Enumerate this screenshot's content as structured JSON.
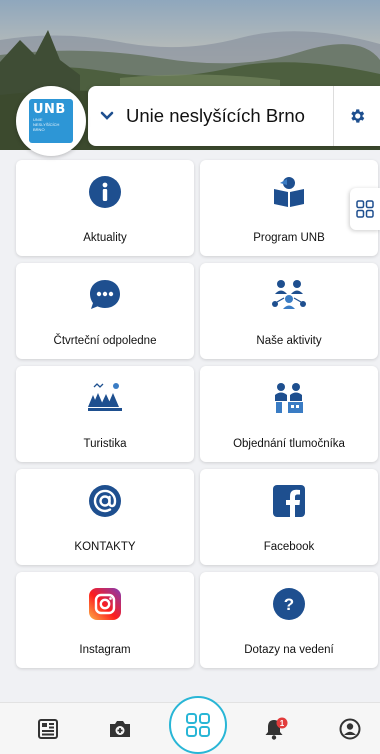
{
  "header": {
    "org_name": "Unie neslyšících Brno",
    "logo_text": "UNB",
    "logo_subtext": [
      "UNIE",
      "NESLYŠÍCÍCH",
      "BRNO"
    ]
  },
  "tiles": [
    {
      "label": "Aktuality",
      "icon": "info-icon"
    },
    {
      "label": "Program UNB",
      "icon": "reading-book-icon"
    },
    {
      "label": "Čtvrteční odpoledne",
      "icon": "chat-bubble-icon"
    },
    {
      "label": "Naše aktivity",
      "icon": "people-network-icon"
    },
    {
      "label": "Turistika",
      "icon": "forest-hiking-icon"
    },
    {
      "label": "Objednání tlumočníka",
      "icon": "interpreter-icon"
    },
    {
      "label": "KONTAKTY",
      "icon": "at-sign-icon"
    },
    {
      "label": "Facebook",
      "icon": "facebook-icon"
    },
    {
      "label": "Instagram",
      "icon": "instagram-icon"
    },
    {
      "label": "Dotazy na vedení",
      "icon": "question-icon"
    }
  ],
  "bottom_nav": {
    "items": [
      "news-feed-icon",
      "add-photo-icon",
      "apps-grid-icon",
      "notifications-icon",
      "profile-icon"
    ],
    "notification_badge": "1"
  },
  "colors": {
    "primary": "#1e4f8f",
    "accent": "#29b6d6",
    "logo_blue": "#2d96d6",
    "badge_red": "#e23b3b"
  }
}
